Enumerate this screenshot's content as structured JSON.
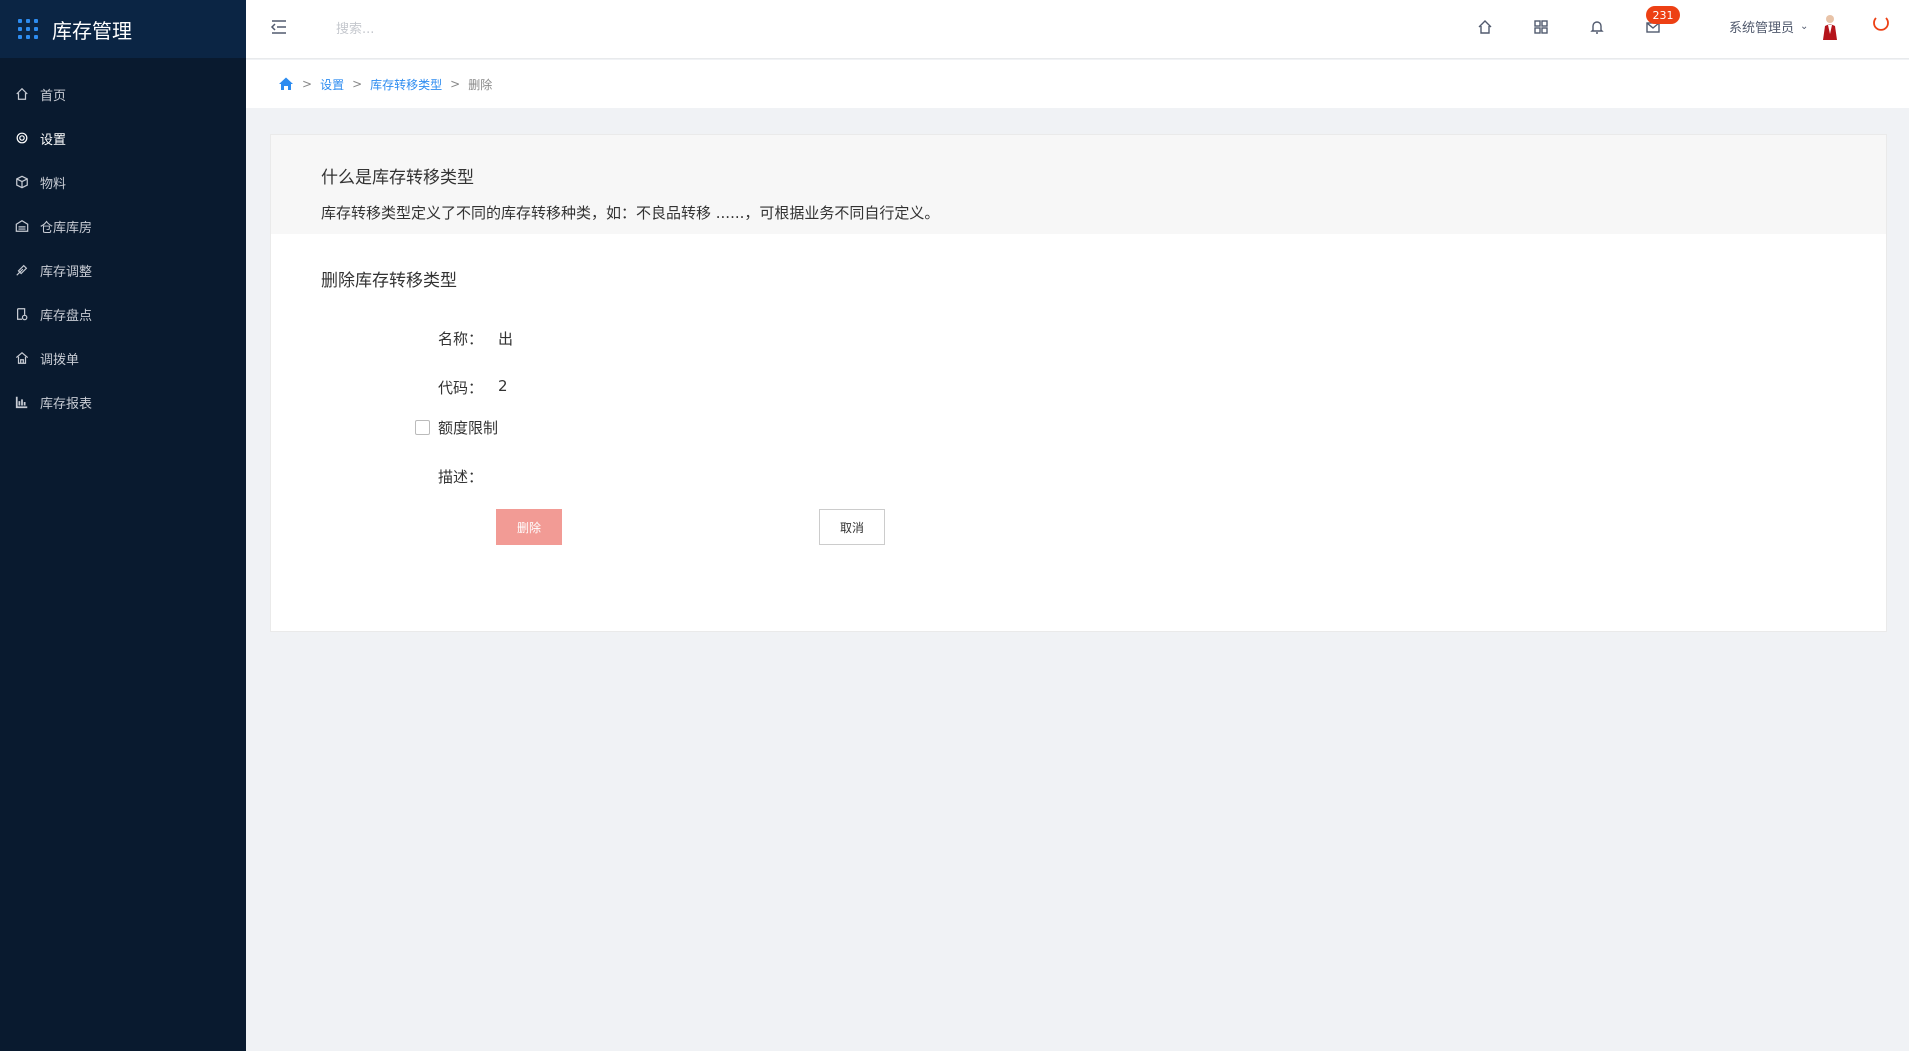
{
  "app": {
    "title": "库存管理"
  },
  "sidebar": {
    "items": [
      {
        "label": "首页",
        "icon": "home-icon"
      },
      {
        "label": "设置",
        "icon": "gear-icon"
      },
      {
        "label": "物料",
        "icon": "box-icon"
      },
      {
        "label": "仓库库房",
        "icon": "warehouse-icon"
      },
      {
        "label": "库存调整",
        "icon": "adjust-icon"
      },
      {
        "label": "库存盘点",
        "icon": "inventory-check-icon"
      },
      {
        "label": "调拨单",
        "icon": "transfer-icon"
      },
      {
        "label": "库存报表",
        "icon": "bar-chart-icon"
      }
    ],
    "active_index": 1
  },
  "header": {
    "search_placeholder": "搜索...",
    "badge_count": "231",
    "user_name": "系统管理员",
    "badge_color": "#ed4014"
  },
  "breadcrumb": {
    "items": [
      "设置",
      "库存转移类型"
    ],
    "current": "删除"
  },
  "intro": {
    "title": "什么是库存转移类型",
    "description": "库存转移类型定义了不同的库存转移种类，如：不良品转移 ......，可根据业务不同自行定义。"
  },
  "form": {
    "title": "删除库存转移类型",
    "name_label": "名称：",
    "name_value": "出",
    "code_label": "代码：",
    "code_value": "2",
    "quota_label": "额度限制",
    "quota_checked": false,
    "desc_label": "描述：",
    "desc_value": "",
    "delete_label": "删除",
    "cancel_label": "取消"
  },
  "colors": {
    "sidebar_bg": "#091a2f",
    "brand_bg": "#0b2544",
    "accent": "#2d8cf0",
    "delete_button": "#f29b95"
  }
}
